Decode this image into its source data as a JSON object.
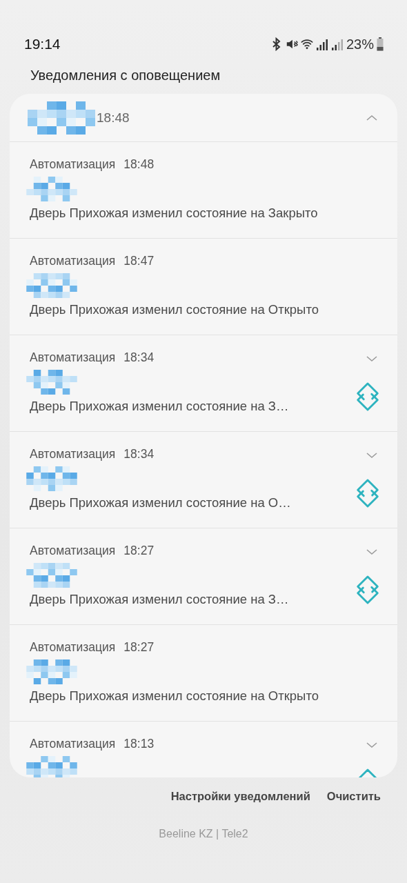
{
  "status_bar": {
    "time": "19:14",
    "battery": "23%"
  },
  "section_title": "Уведомления с оповещением",
  "group": {
    "time": "18:48",
    "expanded": true
  },
  "notifications": [
    {
      "app": "Автоматизация",
      "time": "18:48",
      "message": "Дверь Прихожая изменил состояние на Закрыто",
      "expandable": false,
      "has_icon": false
    },
    {
      "app": "Автоматизация",
      "time": "18:47",
      "message": "Дверь Прихожая изменил состояние на Открыто",
      "expandable": false,
      "has_icon": false
    },
    {
      "app": "Автоматизация",
      "time": "18:34",
      "message": "Дверь Прихожая изменил состояние на З…",
      "expandable": true,
      "has_icon": true
    },
    {
      "app": "Автоматизация",
      "time": "18:34",
      "message": "Дверь Прихожая изменил состояние на О…",
      "expandable": true,
      "has_icon": true
    },
    {
      "app": "Автоматизация",
      "time": "18:27",
      "message": "Дверь Прихожая изменил состояние на З…",
      "expandable": true,
      "has_icon": true
    },
    {
      "app": "Автоматизация",
      "time": "18:27",
      "message": "Дверь Прихожая изменил состояние на Открыто",
      "expandable": false,
      "has_icon": false
    },
    {
      "app": "Автоматизация",
      "time": "18:13",
      "expandable": true,
      "has_icon": true
    }
  ],
  "actions": [
    "Настройки уведомлений",
    "Очистить"
  ],
  "carrier": "Beeline KZ | Tele2"
}
